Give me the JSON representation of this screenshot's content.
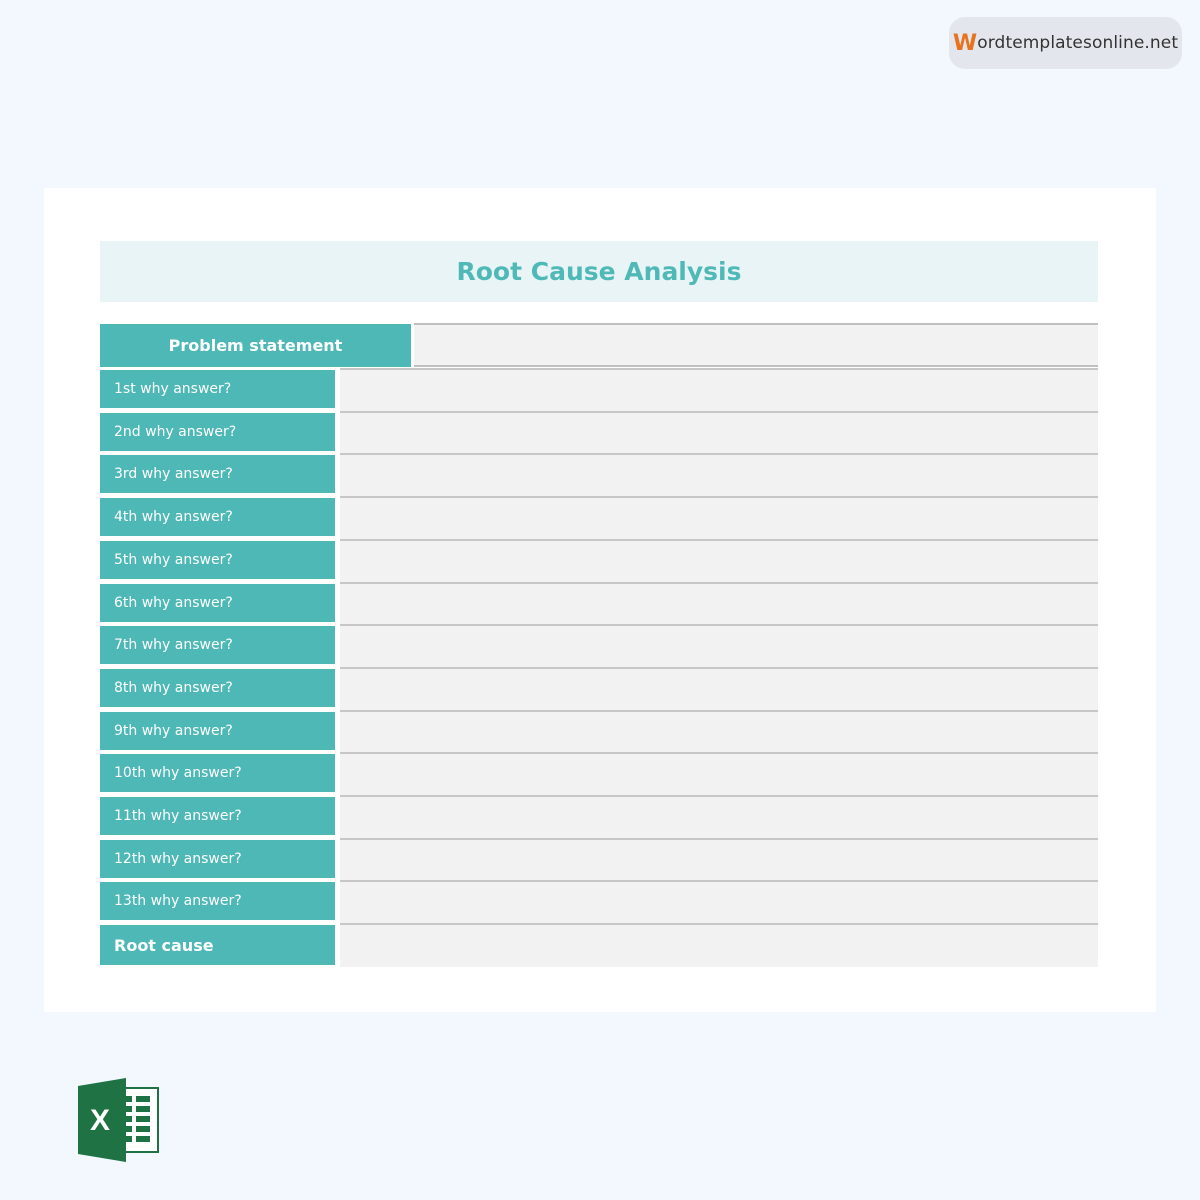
{
  "brand": {
    "first_letter": "W",
    "rest": "ordtemplatesonline.net"
  },
  "sheet": {
    "title": "Root Cause Analysis",
    "problem_label": "Problem statement",
    "rows": [
      "1st why answer?",
      "2nd why answer?",
      "3rd why answer?",
      "4th why answer?",
      "5th why answer?",
      "6th why answer?",
      "7th why answer?",
      "8th why answer?",
      "9th why answer?",
      "10th why answer?",
      "11th why answer?",
      "12th why answer?",
      "13th why answer?"
    ],
    "root_label": "Root cause"
  },
  "icons": {
    "file_type": "excel-logo-icon"
  },
  "colors": {
    "accent": "#4db8b6",
    "title_band": "#e8f4f5",
    "cell_fill": "#f2f2f2",
    "brand_orange": "#e8731f",
    "excel_green": "#1f7244"
  }
}
